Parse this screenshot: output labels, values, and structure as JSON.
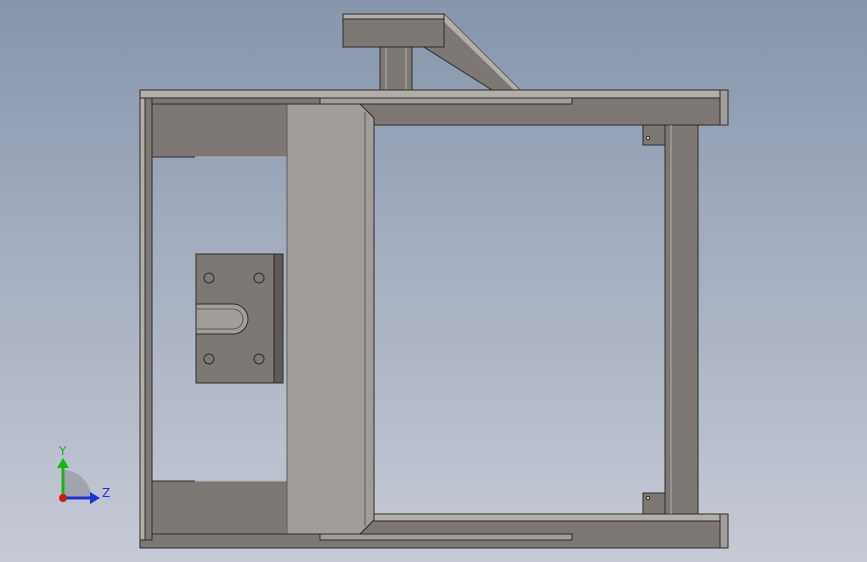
{
  "viewport": {
    "background_top": "#8796ab",
    "background_bottom": "#c6cad5"
  },
  "model": {
    "colors": {
      "steel": "#7d7873",
      "steel_dark": "#5e5a56",
      "steel_light": "#b2aea8",
      "plate": "#a19d98",
      "edge": "#2f2d2b",
      "highlight": "#e6e4e0"
    }
  },
  "triad": {
    "y_label": "Y",
    "z_label": "Z",
    "y_color": "#18b418",
    "z_color": "#1a33d6",
    "x_color": "#d01a1a"
  }
}
